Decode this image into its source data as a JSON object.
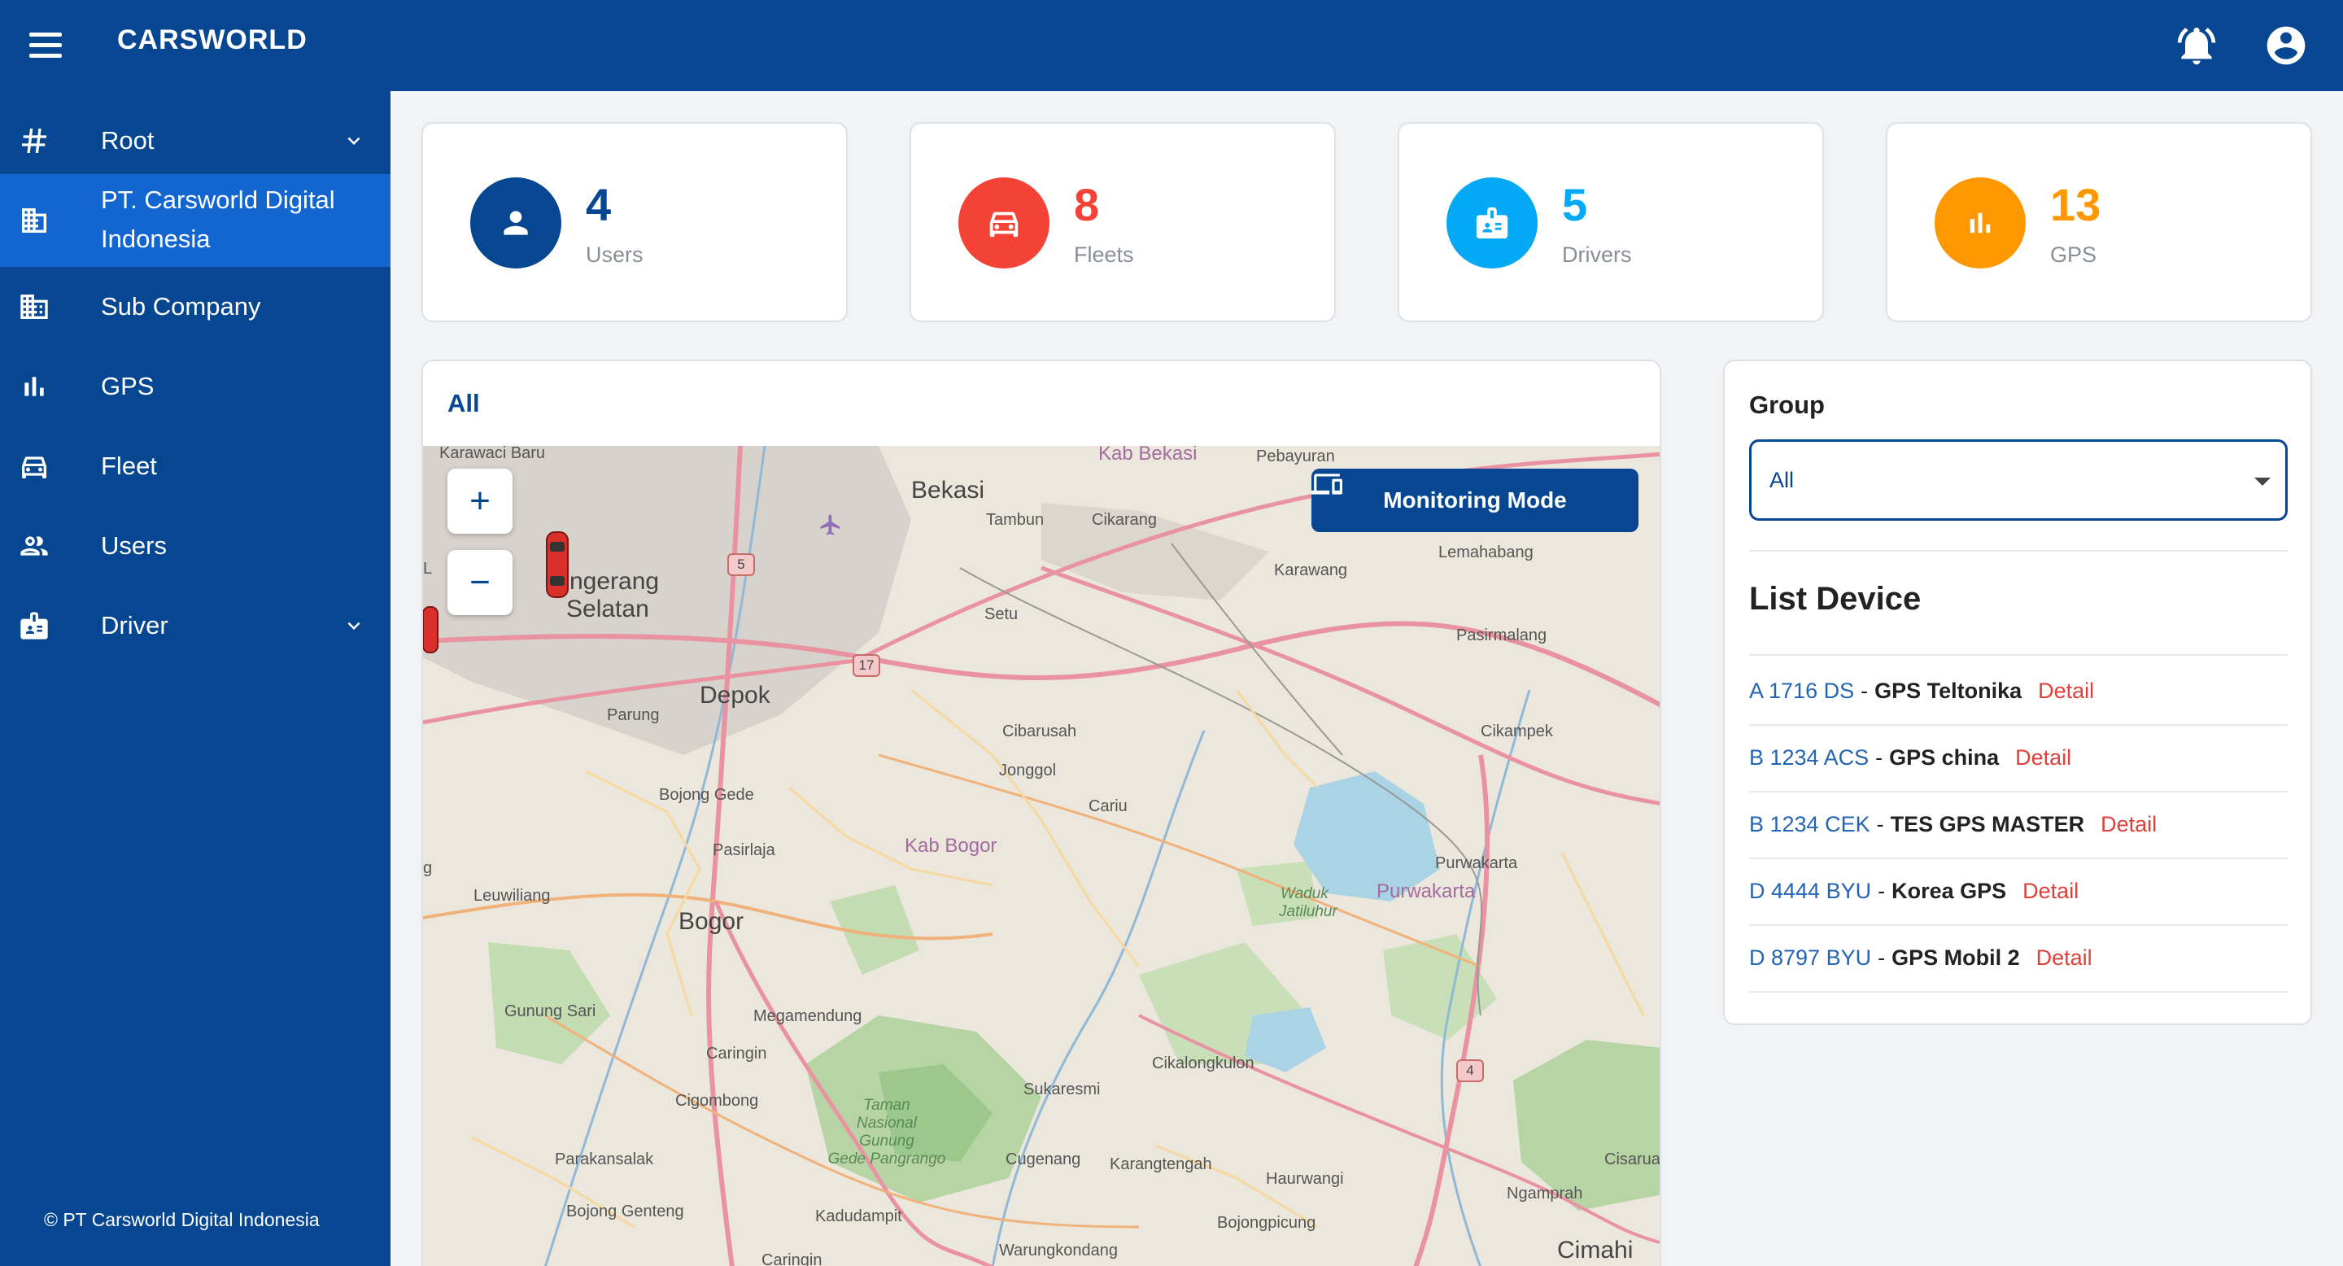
{
  "header": {
    "brand": "CARSWORLD",
    "menu_icon": "hamburger-icon",
    "notification_icon": "bell-icon",
    "account_icon": "account-circle-icon"
  },
  "sidebar": {
    "items": [
      {
        "label": "Root",
        "icon": "hash-icon",
        "expandable": true
      },
      {
        "label": "PT. Carsworld Digital Indonesia",
        "icon": "office-building-icon",
        "active": true
      },
      {
        "label": "Sub Company",
        "icon": "building-icon"
      },
      {
        "label": "GPS",
        "icon": "signal-bars-icon"
      },
      {
        "label": "Fleet",
        "icon": "car-icon"
      },
      {
        "label": "Users",
        "icon": "users-icon"
      },
      {
        "label": "Driver",
        "icon": "badge-icon",
        "expandable": true
      }
    ],
    "footer": "© PT Carsworld Digital Indonesia"
  },
  "stats": [
    {
      "value": "4",
      "label": "Users",
      "color": "#074792",
      "icon": "user-icon"
    },
    {
      "value": "8",
      "label": "Fleets",
      "color": "#f44336",
      "icon": "car-icon"
    },
    {
      "value": "5",
      "label": "Drivers",
      "color": "#03a9f4",
      "icon": "badge-icon"
    },
    {
      "value": "13",
      "label": "GPS",
      "color": "#ff9800",
      "icon": "signal-bars-icon"
    }
  ],
  "map": {
    "header": "All",
    "monitoring_button": "Monitoring Mode",
    "zoom_in": "+",
    "zoom_out": "−",
    "labels": {
      "karawaci_baru": "Karawaci Baru",
      "kab_bekasi": "Kab Bekasi",
      "pebayuran": "Pebayuran",
      "bekasi": "Bekasi",
      "tambun": "Tambun",
      "cikarang": "Cikarang",
      "karawang": "Karawang",
      "lemahabang": "Lemahabang",
      "tangerang_selatan_1": "ngerang",
      "tangerang_selatan_2": "Selatan",
      "setu": "Setu",
      "pasirmalang": "Pasirmalang",
      "depok": "Depok",
      "parung": "Parung",
      "cibarusah": "Cibarusah",
      "jonggol": "Jonggol",
      "cikampek": "Cikampek",
      "bojong_gede": "Bojong Gede",
      "cariu": "Cariu",
      "pasirlaja": "Pasirlaja",
      "kab_bogor": "Kab Bogor",
      "purwakarta_town": "Purwakarta",
      "waduk_1": "Waduk",
      "waduk_2": "Jatiluhur",
      "purwakarta_region": "Purwakarta",
      "leuwiliang": "Leuwiliang",
      "bogor": "Bogor",
      "gunung_sari": "Gunung Sari",
      "megamendung": "Megamendung",
      "caringin": "Caringin",
      "cikalongkulon": "Cikalongkulon",
      "cigombong": "Cigombong",
      "sukaresmi": "Sukaresmi",
      "park_1": "Taman",
      "park_2": "Nasional",
      "park_3": "Gunung",
      "park_4": "Gede Pangrango",
      "parakansalak": "Parakansalak",
      "cugenang": "Cugenang",
      "karangtengah": "Karangtengah",
      "cisarua": "Cisarua",
      "haurwangi": "Haurwangi",
      "ngamprah": "Ngamprah",
      "bojong_genteng": "Bojong Genteng",
      "kadudampit": "Kadudampit",
      "warungkondang": "Warungkondang",
      "bojongpicung": "Bojongpicung",
      "cimahi": "Cimahi",
      "caringin2": "Caringin",
      "l": "L",
      "g": "g"
    },
    "shields": [
      "5",
      "17",
      "4"
    ]
  },
  "group": {
    "title": "Group",
    "selected": "All",
    "list_title": "List Device",
    "devices": [
      {
        "plate": "A 1716 DS",
        "name": "GPS Teltonika",
        "detail": "Detail"
      },
      {
        "plate": "B 1234 ACS",
        "name": "GPS china",
        "detail": "Detail"
      },
      {
        "plate": "B 1234 CEK",
        "name": "TES GPS MASTER",
        "detail": "Detail"
      },
      {
        "plate": "D 4444 BYU",
        "name": "Korea GPS",
        "detail": "Detail"
      },
      {
        "plate": "D 8797 BYU",
        "name": "GPS Mobil 2",
        "detail": "Detail"
      }
    ],
    "separator": "-"
  }
}
